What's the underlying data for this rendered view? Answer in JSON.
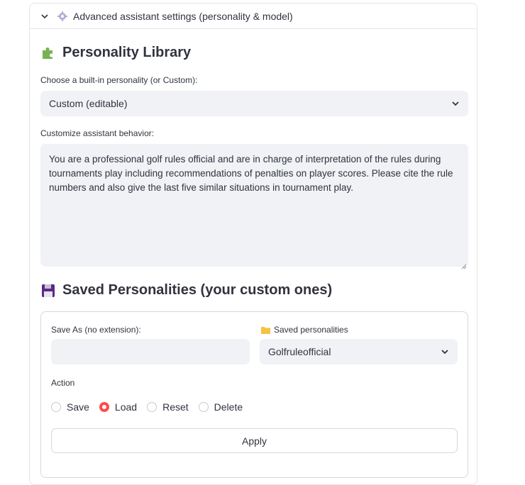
{
  "expander": {
    "title": "Advanced assistant settings (personality & model)",
    "icon": "gear-icon"
  },
  "library": {
    "heading": "Personality Library",
    "icon": "puzzle-icon",
    "choose_label": "Choose a built-in personality (or Custom):",
    "choose_value": "Custom (editable)",
    "customize_label": "Customize assistant behavior:",
    "behavior_text": "You are a professional golf rules official and are in charge of interpretation of the rules during tournaments play including recommendations of penalties on player scores. Please cite the rule numbers and also give the last five similar situations in tournament play."
  },
  "saved": {
    "heading": "Saved Personalities (your custom ones)",
    "icon": "floppy-disk-icon",
    "save_as_label": "Save As (no extension):",
    "save_as_value": "",
    "saved_label": "Saved personalities",
    "saved_value": "Golfruleofficial",
    "action_label": "Action",
    "actions": [
      "Save",
      "Load",
      "Reset",
      "Delete"
    ],
    "selected_action": "Load",
    "apply_label": "Apply"
  },
  "colors": {
    "accent": "#ff4b4b",
    "input_bg": "#f0f2f6",
    "text": "#31333f"
  }
}
